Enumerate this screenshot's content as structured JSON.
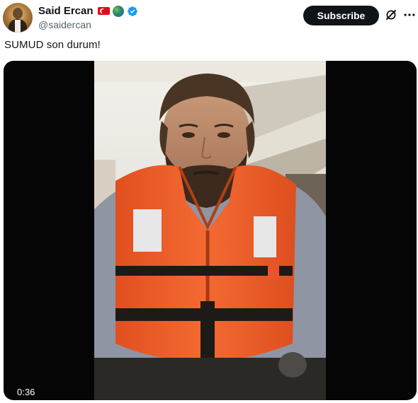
{
  "author": {
    "display_name": "Said Ercan",
    "handle": "@saidercan",
    "badges": [
      "turkey-flag-icon",
      "globe-icon",
      "verified-icon"
    ]
  },
  "actions": {
    "subscribe_label": "Subscribe",
    "grok_icon": "grok-icon",
    "more_icon": "more-icon"
  },
  "post": {
    "text": "SUMUD son durum!"
  },
  "media": {
    "type": "video",
    "duration": "0:36"
  },
  "colors": {
    "text_primary": "#0f1419",
    "text_secondary": "#536471",
    "verified_blue": "#1d9bf0",
    "media_background": "#050505",
    "life_jacket_orange": "#f2622a"
  }
}
